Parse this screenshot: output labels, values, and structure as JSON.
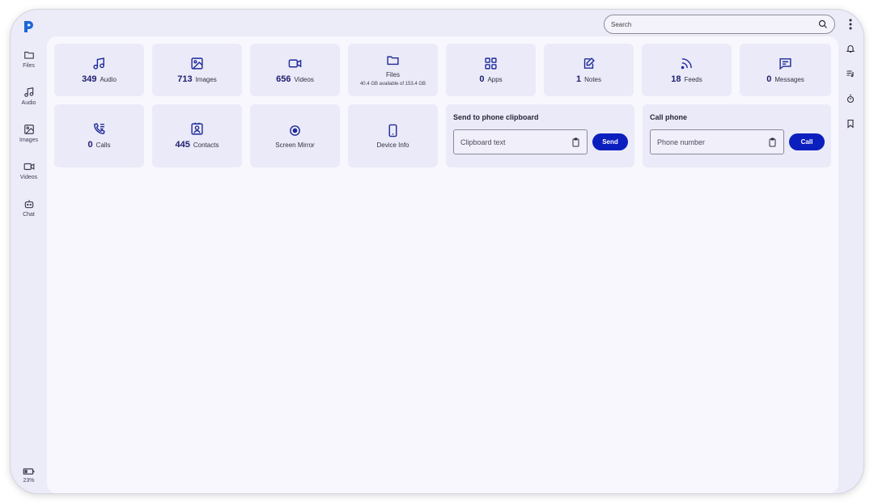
{
  "app": {
    "logo_icon": "p-logo-icon",
    "accent_color": "#0b1fbf"
  },
  "sidebar": {
    "items": [
      {
        "label": "Files",
        "icon": "folder-icon"
      },
      {
        "label": "Audio",
        "icon": "music-note-icon"
      },
      {
        "label": "Images",
        "icon": "image-icon"
      },
      {
        "label": "Videos",
        "icon": "video-icon"
      },
      {
        "label": "Chat",
        "icon": "chat-bot-icon"
      }
    ],
    "battery": {
      "label": "23%",
      "icon": "battery-icon"
    }
  },
  "search": {
    "placeholder": "Search",
    "value": ""
  },
  "rightbar": {
    "icons": [
      "bell-icon",
      "playlist-icon",
      "timer-icon",
      "bookmark-icon"
    ]
  },
  "cards": [
    {
      "count": "349",
      "label": "Audio",
      "icon": "music-note-icon"
    },
    {
      "count": "713",
      "label": "Images",
      "icon": "image-icon"
    },
    {
      "count": "656",
      "label": "Videos",
      "icon": "video-icon"
    },
    {
      "count": "",
      "label": "Files",
      "sub": "40.4 GB available of 153.4 GB",
      "icon": "folder-icon"
    },
    {
      "count": "0",
      "label": "Apps",
      "icon": "apps-grid-icon"
    },
    {
      "count": "1",
      "label": "Notes",
      "icon": "note-edit-icon"
    },
    {
      "count": "18",
      "label": "Feeds",
      "icon": "rss-feed-icon"
    },
    {
      "count": "0",
      "label": "Messages",
      "icon": "message-icon"
    },
    {
      "count": "0",
      "label": "Calls",
      "icon": "phone-list-icon"
    },
    {
      "count": "445",
      "label": "Contacts",
      "icon": "contact-icon"
    },
    {
      "count": "",
      "label": "Screen Mirror",
      "icon": "screen-mirror-icon"
    },
    {
      "count": "",
      "label": "Device Info",
      "icon": "phone-device-icon"
    }
  ],
  "clipboard_panel": {
    "title": "Send to phone clipboard",
    "placeholder": "Clipboard text",
    "button": "Send",
    "icon": "clipboard-icon"
  },
  "call_panel": {
    "title": "Call phone",
    "placeholder": "Phone number",
    "button": "Call",
    "icon": "clipboard-icon"
  }
}
